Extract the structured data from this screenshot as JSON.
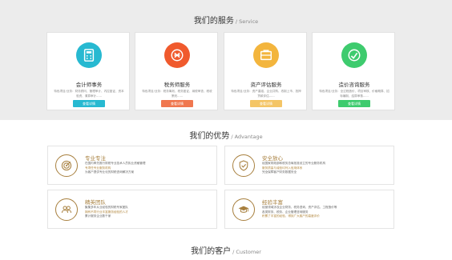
{
  "services": {
    "title_zh": "我们的服务",
    "title_en": "/ Service",
    "items": [
      {
        "name": "会计师事务",
        "desc": "特色项目/业务：财务顾问、管理审计、内控鉴证、资本验资、清算审计......",
        "button": "查看详情",
        "color": "#27b9d1",
        "icon": "calculator-icon"
      },
      {
        "name": "税务师服务",
        "desc": "特色项目/业务：税务筹划、税务鉴证、纳税审查、税收策划......",
        "button": "查看详情",
        "color": "#f05a2d",
        "icon": "tax-icon"
      },
      {
        "name": "资产评估服务",
        "desc": "特色项目/业务：资产重组、企业并购、改制上市、抵押贷款评估......",
        "button": "查看详情",
        "color": "#f3b53d",
        "icon": "asset-icon"
      },
      {
        "name": "造价咨询服务",
        "desc": "特色项目/业务：全过程造价、项目审核、价格概算、招标编制、结算审核......",
        "button": "查看详情",
        "color": "#3ecb6e",
        "icon": "cost-icon"
      }
    ]
  },
  "advantage": {
    "title_zh": "我们的优势",
    "title_en": "/ Advantage",
    "items": [
      {
        "title": "专业专注",
        "icon": "target-icon",
        "lines": [
          "在国内率先推行财税专业技术人员执业资格管理",
          "专项任专业服务机构",
          "为客户提供专业化的财税咨询解决方案"
        ]
      },
      {
        "title": "安全放心",
        "icon": "shield-check-icon",
        "lines": [
          "经国家财政部和税务总局批准设立的专业服务机构",
          "服务质量与诚信均列入信用体系",
          "完全保障客户财务数据安全"
        ]
      },
      {
        "title": "精英团队",
        "icon": "team-icon",
        "lines": [
          "聚集多年从业经验的财税专家团队",
          "拥有不同行业丰富服务经验的人才",
          "累计服务企业数千家"
        ]
      },
      {
        "title": "经验丰富",
        "icon": "graduation-cap-icon",
        "lines": [
          "经营领域涉及企业财务、税务咨询、资产评估、工程造价等",
          "各类财务、税务、企业管理咨询服务",
          "积累了丰富的经验，得到广大客户的高度评价"
        ]
      }
    ]
  },
  "customer": {
    "title_zh": "我们的客户",
    "title_en": "/ Customer"
  }
}
